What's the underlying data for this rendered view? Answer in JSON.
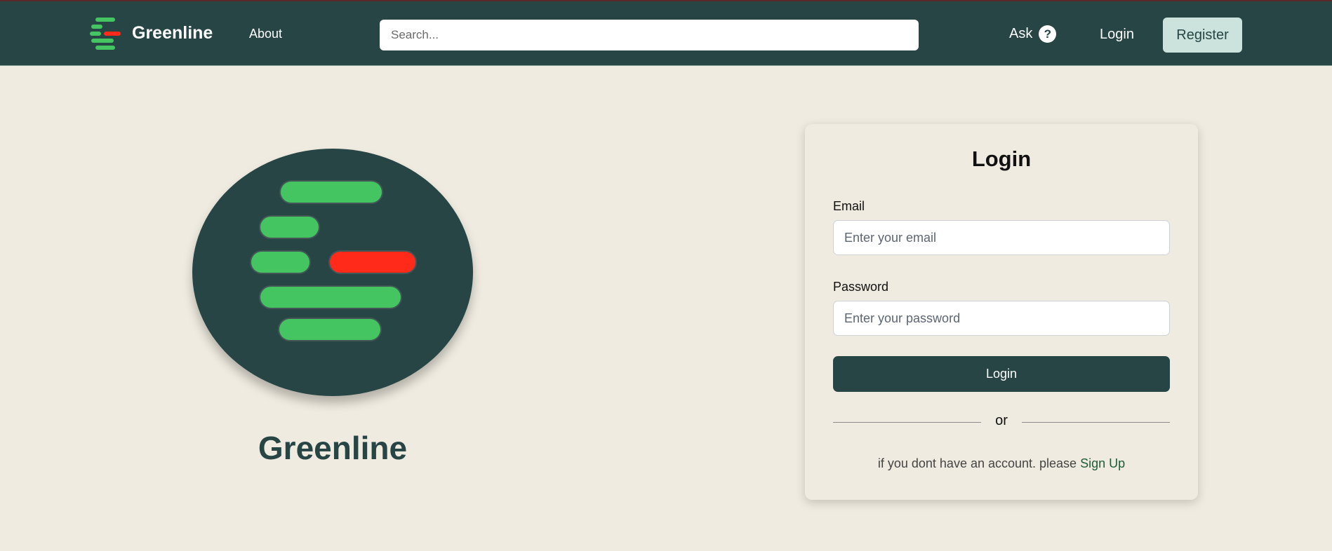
{
  "header": {
    "brand_name": "Greenline",
    "about_label": "About",
    "search_placeholder": "Search...",
    "ask_label": "Ask",
    "ask_icon_glyph": "?",
    "login_label": "Login",
    "register_label": "Register"
  },
  "hero": {
    "title": "Greenline"
  },
  "login_card": {
    "title": "Login",
    "email_label": "Email",
    "email_placeholder": "Enter your email",
    "email_value": "",
    "password_label": "Password",
    "password_placeholder": "Enter your password",
    "password_value": "",
    "submit_label": "Login",
    "divider_text": "or",
    "signup_prompt": "if you dont have an account. please",
    "signup_link": "Sign Up"
  },
  "colors": {
    "header_bg": "#264544",
    "page_bg": "#efebe0",
    "accent_green": "#45c462",
    "accent_red": "#ff2a1a",
    "register_bg": "#cbe3dc",
    "link_green": "#1e5c36"
  },
  "icons": {
    "brand_logo": "greenline-logo-icon",
    "ask": "question-mark-icon"
  }
}
